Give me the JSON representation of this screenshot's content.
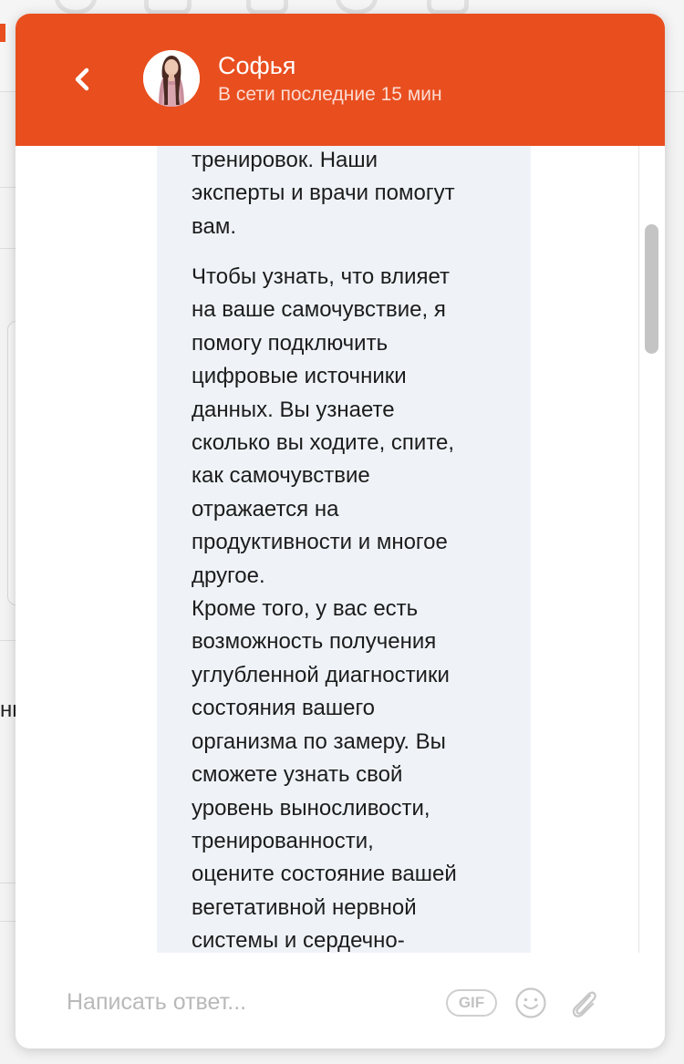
{
  "header": {
    "contact_name": "Софья",
    "status": "В сети последние 15 мин",
    "back_icon": "chevron-left-icon",
    "accent_color": "#e94e1e"
  },
  "message": {
    "paragraphs": [
      "тренировок. Наши\nэксперты и врачи помогут\nвам.",
      "Чтобы узнать, что влияет\nна ваше самочувствие, я\nпомогу подключить\nцифровые источники\nданных. Вы узнаете\nсколько вы ходите, спите,\nкак самочувствие\nотражается на\nпродуктивности и многое\nдругое.\nКроме того, у вас есть\nвозможность получения\nуглубленной диагностики\nсостояния вашего\nорганизма по замеру. Вы\nсможете узнать свой\nуровень выносливости,\nтренированности,\nоцените состояние вашей\nвегетативной нервной\nсистемы и сердечно-"
    ]
  },
  "composer": {
    "placeholder": "Написать ответ...",
    "gif_label": "GIF",
    "emoji_icon": "smiley-icon",
    "attach_icon": "paperclip-icon"
  },
  "background": {
    "fragment_text": "нь"
  }
}
